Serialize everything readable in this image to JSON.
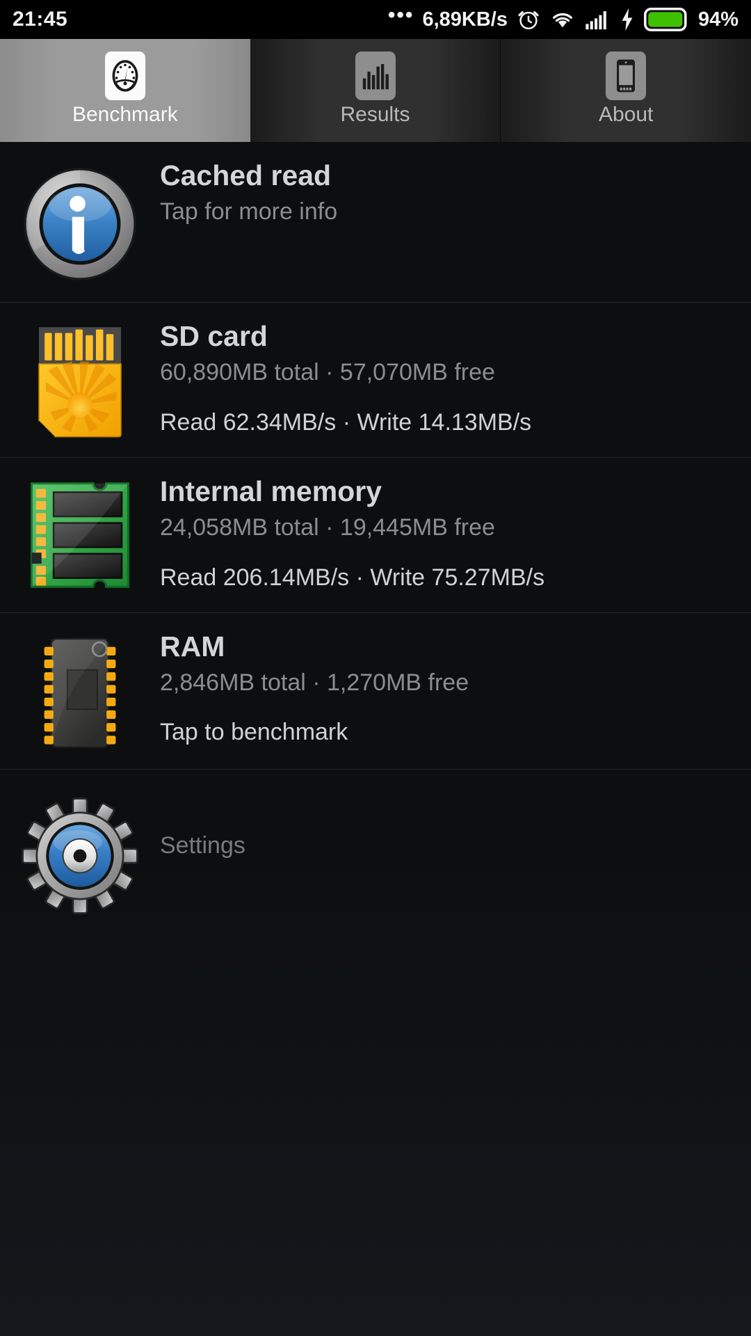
{
  "statusbar": {
    "clock": "21:45",
    "dots": "•••",
    "netspeed": "6,89KB/s",
    "battery_percent": "94%",
    "icons": [
      "alarm-clock-icon",
      "wifi-icon",
      "signal-icon",
      "charging-bolt-icon",
      "battery-icon"
    ],
    "battery_color": "#3fc000"
  },
  "tabs": [
    {
      "label": "Benchmark",
      "icon": "speedometer-icon",
      "active": true
    },
    {
      "label": "Results",
      "icon": "bar-chart-icon",
      "active": false
    },
    {
      "label": "About",
      "icon": "phone-icon",
      "active": false
    }
  ],
  "rows": [
    {
      "id": "cached-read",
      "icon": "info-icon",
      "title": "Cached read",
      "sub": "",
      "action": "Tap for more info",
      "action_dim": false
    },
    {
      "id": "sd-card",
      "icon": "sd-card-icon",
      "title": "SD card",
      "sub": "60,890MB total · 57,070MB free",
      "action": "Read 62.34MB/s · Write 14.13MB/s",
      "action_dim": false
    },
    {
      "id": "internal-memory",
      "icon": "memory-module-icon",
      "title": "Internal memory",
      "sub": "24,058MB total · 19,445MB free",
      "action": "Read 206.14MB/s · Write 75.27MB/s",
      "action_dim": false
    },
    {
      "id": "ram",
      "icon": "ram-chip-icon",
      "title": "RAM",
      "sub": "2,846MB total · 1,270MB free",
      "action": "Tap to benchmark",
      "action_dim": false
    }
  ],
  "settings": {
    "label": "Settings",
    "icon": "gear-icon"
  },
  "colors": {
    "background": "#0c0e10",
    "tab_active": "#9b9b9b",
    "accent_blue": "#2f7fd0",
    "accent_gold": "#f5a200",
    "accent_green": "#2f9e41"
  }
}
